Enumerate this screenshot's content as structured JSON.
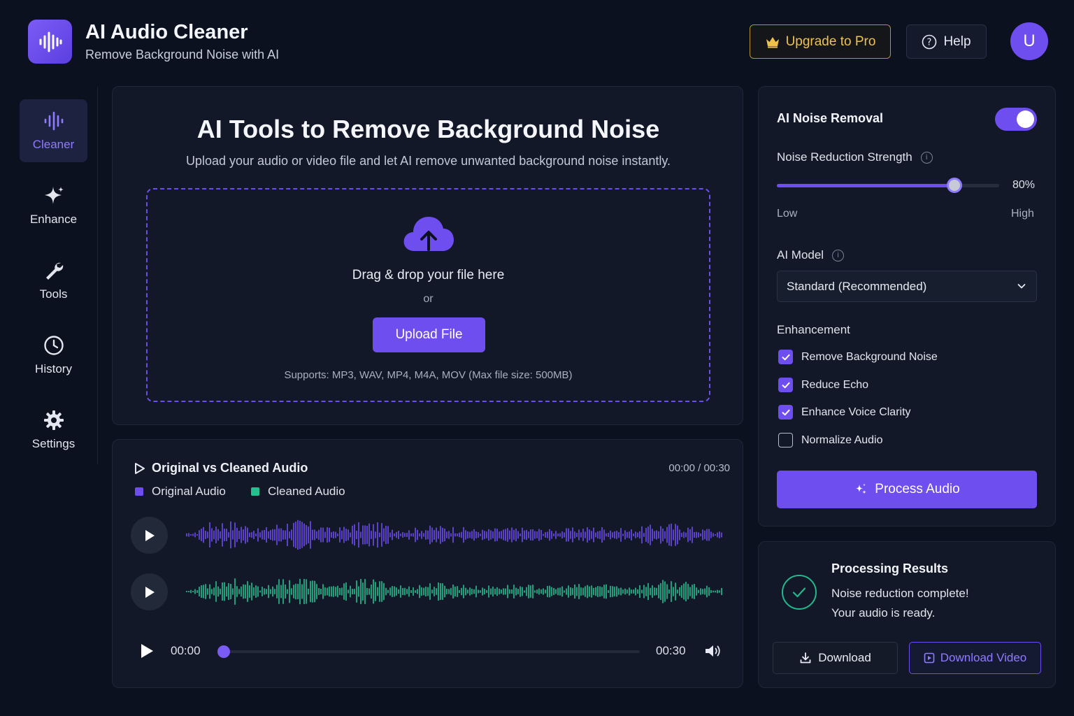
{
  "header": {
    "title": "AI Audio Cleaner",
    "subtitle": "Remove Background Noise with AI",
    "upgrade_label": "Upgrade to Pro",
    "help_label": "Help",
    "avatar_initial": "U"
  },
  "sidebar": {
    "items": [
      {
        "label": "Cleaner",
        "icon": "waveform-icon",
        "active": true
      },
      {
        "label": "Enhance",
        "icon": "sparkle-icon",
        "active": false
      },
      {
        "label": "Tools",
        "icon": "wrench-icon",
        "active": false
      },
      {
        "label": "History",
        "icon": "clock-icon",
        "active": false
      },
      {
        "label": "Settings",
        "icon": "gear-icon",
        "active": false
      }
    ]
  },
  "upload": {
    "title": "AI Tools to Remove Background Noise",
    "subtitle": "Upload your audio or video file and let AI remove unwanted background noise instantly.",
    "drop_text": "Drag & drop your file here",
    "or_text": "or",
    "button_label": "Upload File",
    "supports_text": "Supports: MP3, WAV, MP4, M4A, MOV  (Max file size: 500MB)"
  },
  "waveform": {
    "title": "Original vs Cleaned Audio",
    "time": "00:00 / 00:30",
    "legend": [
      {
        "label": "Original Audio",
        "color": "#6f4ef0"
      },
      {
        "label": "Cleaned Audio",
        "color": "#26c08f"
      }
    ],
    "start_time": "00:00",
    "end_time": "00:30",
    "playback_progress": 0
  },
  "settings": {
    "noise_removal_label": "AI Noise Removal",
    "noise_removal_on": true,
    "strength_label": "Noise Reduction Strength",
    "strength_value": "80%",
    "strength_fraction": 0.8,
    "low_label": "Low",
    "high_label": "High",
    "model_label": "AI Model",
    "model_value": "Standard (Recommended)",
    "enhancement_label": "Enhancement",
    "options": [
      {
        "label": "Remove Background Noise",
        "checked": true
      },
      {
        "label": "Reduce Echo",
        "checked": true
      },
      {
        "label": "Enhance Voice Clarity",
        "checked": true
      },
      {
        "label": "Normalize Audio",
        "checked": false
      }
    ],
    "process_label": "Process Audio"
  },
  "results": {
    "title": "Processing Results",
    "line1": "Noise reduction complete!",
    "line2": "Your audio is ready.",
    "download_label": "Download",
    "download_video_label": "Download Video"
  },
  "colors": {
    "accent": "#6f4ef0",
    "success": "#26c08f",
    "gold": "#f0c14b",
    "background": "#0c1120"
  }
}
